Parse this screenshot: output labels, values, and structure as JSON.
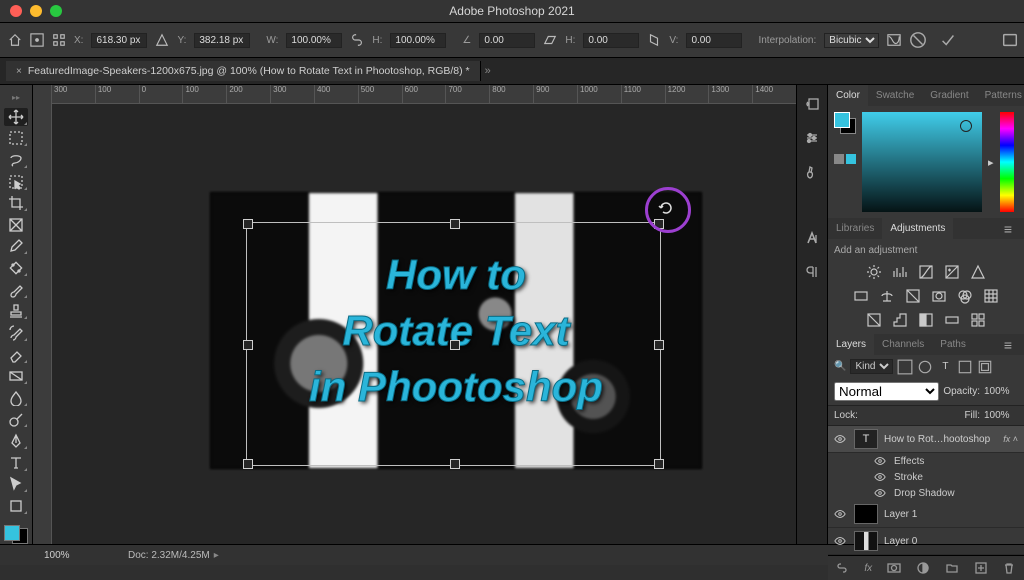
{
  "app_title": "Adobe Photoshop 2021",
  "doc_tab": "FeaturedImage-Speakers-1200x675.jpg @ 100% (How to Rotate Text in Phootoshop, RGB/8) *",
  "optbar": {
    "x_label": "X:",
    "x": "618.30 px",
    "y_label": "Y:",
    "y": "382.18 px",
    "w_label": "W:",
    "w": "100.00%",
    "h_label": "H:",
    "h": "100.00%",
    "angle_label": "∠",
    "angle": "0.00",
    "skew_h_label": "H:",
    "skew_h": "0.00",
    "skew_v_label": "V:",
    "skew_v": "0.00",
    "interp_label": "Interpolation:",
    "interp": "Bicubic"
  },
  "ruler_marks": [
    "300",
    "100",
    "0",
    "100",
    "200",
    "300",
    "400",
    "500",
    "600",
    "700",
    "800",
    "900",
    "1000",
    "1100",
    "1200",
    "1300",
    "1400"
  ],
  "canvas_text": {
    "l1": "How to",
    "l2": "Rotate Text",
    "l3": "in Phootoshop"
  },
  "zoom": "100%",
  "doc_size": "Doc: 2.32M/4.25M",
  "color_panel": {
    "tabs": [
      "Color",
      "Swatche",
      "Gradient",
      "Patterns"
    ]
  },
  "adjust_panel": {
    "tabs": [
      "Libraries",
      "Adjustments"
    ],
    "hint": "Add an adjustment"
  },
  "layers_panel": {
    "tabs": [
      "Layers",
      "Channels",
      "Paths"
    ],
    "filter_kind": "Kind",
    "blend": "Normal",
    "opacity_lbl": "Opacity:",
    "opacity": "100%",
    "lock_lbl": "Lock:",
    "fill_lbl": "Fill:",
    "fill": "100%",
    "layers": [
      {
        "name": "How to Rot…hootoshop",
        "thumb": "T",
        "fx": true,
        "sel": true
      },
      {
        "name": "Layer 1",
        "thumb": "bw"
      },
      {
        "name": "Layer 0",
        "thumb": "bw"
      }
    ],
    "effects_lbl": "Effects",
    "effect1": "Stroke",
    "effect2": "Drop Shadow"
  }
}
